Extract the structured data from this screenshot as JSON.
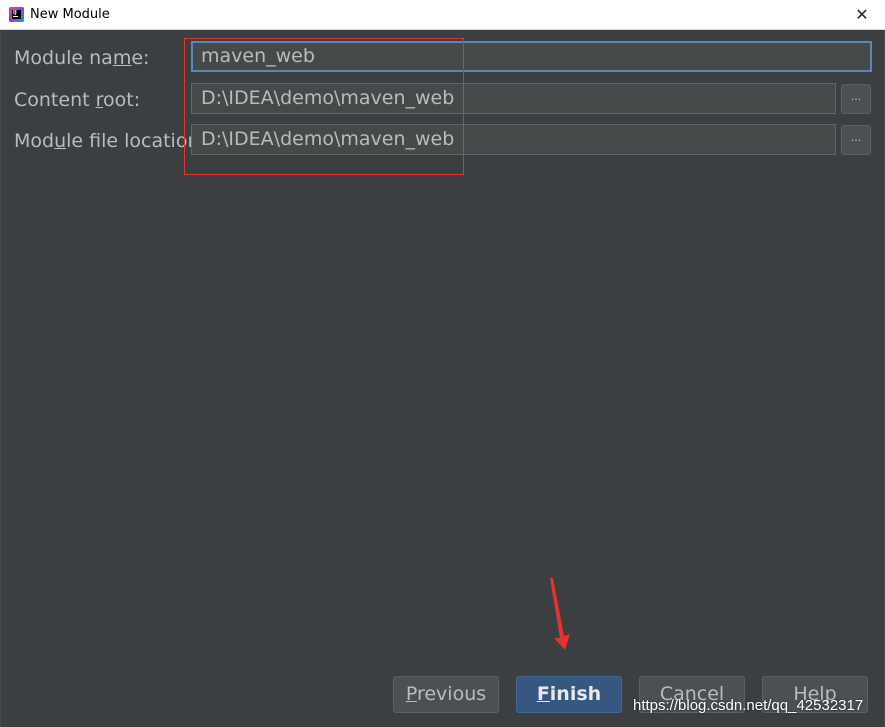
{
  "window": {
    "title": "New Module",
    "close_glyph": "✕",
    "icon": "intellij-idea-icon"
  },
  "form": {
    "module_name": {
      "label_pre": "Module na",
      "label_mnemonic": "m",
      "label_post": "e:",
      "value": "maven_web"
    },
    "content_root": {
      "label_pre": "Content ",
      "label_mnemonic": "r",
      "label_post": "oot:",
      "value": "D:\\IDEA\\demo\\maven_web",
      "browse_label": "..."
    },
    "module_file_location": {
      "label_pre": "Mod",
      "label_mnemonic": "u",
      "label_post": "le file location:",
      "value": "D:\\IDEA\\demo\\maven_web",
      "browse_label": "..."
    }
  },
  "buttons": {
    "previous": {
      "mnemonic": "P",
      "rest": "revious"
    },
    "finish": {
      "mnemonic": "F",
      "rest": "inish"
    },
    "cancel": {
      "label": "Cancel"
    },
    "help": {
      "label": "Help"
    }
  },
  "watermark": "https://blog.csdn.net/qq_42532317",
  "colors": {
    "background": "#3c3f41",
    "annotation": "#e53333",
    "primary_button": "#365880",
    "focus_border": "#5a88b5"
  }
}
